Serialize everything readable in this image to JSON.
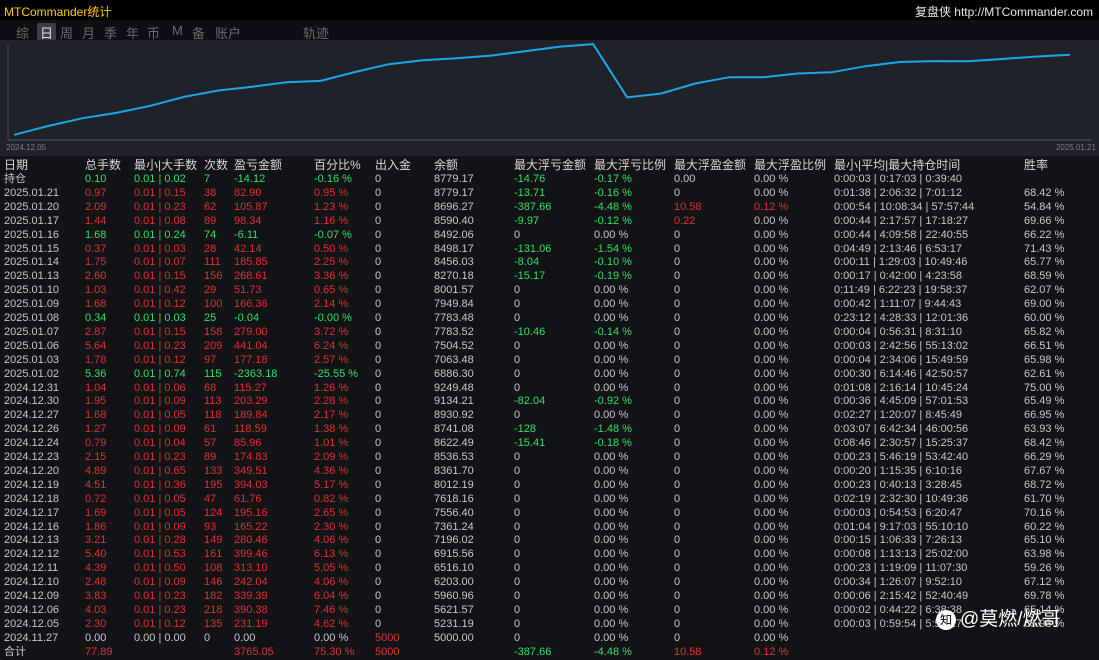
{
  "titlebar": {
    "app_title": "MTCommander统计",
    "brand": "复盘侠 http://MTCommander.com"
  },
  "tabs": [
    {
      "label": "综",
      "active": false
    },
    {
      "label": "日",
      "active": true
    },
    {
      "label": "周",
      "active": false
    },
    {
      "label": "月",
      "active": false
    },
    {
      "label": "季",
      "active": false
    },
    {
      "label": "年",
      "active": false
    },
    {
      "label": "币",
      "active": false
    },
    {
      "label": "M",
      "active": false
    },
    {
      "label": "备",
      "active": false
    },
    {
      "label": "账户",
      "active": false
    },
    {
      "label": "轨迹",
      "active": false
    }
  ],
  "colors": {
    "line": "#1ea7e8",
    "chart_bg": "#1f2329",
    "loss": "#e03030",
    "profit": "#30e060"
  },
  "chart_data": {
    "type": "line",
    "x_start_label": "2024.12.05",
    "x_end_label": "2025.01.21",
    "x": [
      "2024.12.05",
      "2024.12.06",
      "2024.12.09",
      "2024.12.10",
      "2024.12.11",
      "2024.12.12",
      "2024.12.13",
      "2024.12.16",
      "2024.12.17",
      "2024.12.18",
      "2024.12.19",
      "2024.12.20",
      "2024.12.23",
      "2024.12.24",
      "2024.12.26",
      "2024.12.27",
      "2024.12.30",
      "2024.12.31",
      "2025.01.02",
      "2025.01.03",
      "2025.01.06",
      "2025.01.07",
      "2025.01.08",
      "2025.01.09",
      "2025.01.10",
      "2025.01.13",
      "2025.01.14",
      "2025.01.15",
      "2025.01.16",
      "2025.01.17",
      "2025.01.20",
      "2025.01.21"
    ],
    "values": [
      5231.19,
      5621.57,
      5960.96,
      6203.0,
      6516.1,
      6915.56,
      7196.02,
      7361.24,
      7556.4,
      7618.16,
      8012.19,
      8361.7,
      8536.53,
      8622.49,
      8741.08,
      8930.92,
      9134.21,
      9249.48,
      6886.3,
      7063.48,
      7504.52,
      7783.52,
      7783.48,
      7949.84,
      8001.57,
      8270.18,
      8456.03,
      8498.17,
      8492.06,
      8590.4,
      8696.27,
      8779.17
    ],
    "ylim": [
      5000,
      9300
    ]
  },
  "table": {
    "headers": [
      "日期",
      "总手数",
      "最小|大手数",
      "次数",
      "盈亏金额",
      "百分比%",
      "出入金",
      "余额",
      "最大浮亏金额",
      "最大浮亏比例",
      "最大浮盈金额",
      "最大浮盈比例",
      "最小|平均|最大持仓时间",
      "胜率"
    ],
    "rows": [
      [
        "持仓",
        "0.10",
        "0.01 | 0.02",
        "7",
        "-14.12",
        "-0.16 %",
        "0",
        "8779.17",
        "-14.76",
        "-0.17 %",
        "0.00",
        "0.00 %",
        "0:00:03 | 0:17:03 | 0:39:40",
        ""
      ],
      [
        "2025.01.21",
        "0.97",
        "0.01 | 0.15",
        "38",
        "82.90",
        "0.95 %",
        "0",
        "8779.17",
        "-13.71",
        "-0.16 %",
        "0",
        "0.00 %",
        "0:01:38 | 2:06:32 | 7:01:12",
        "68.42 %"
      ],
      [
        "2025.01.20",
        "2.09",
        "0.01 | 0.23",
        "62",
        "105.87",
        "1.23 %",
        "0",
        "8696.27",
        "-387.66",
        "-4.48 %",
        "10.58",
        "0.12 %",
        "0:00:54 | 10:08:34 | 57:57:44",
        "54.84 %"
      ],
      [
        "2025.01.17",
        "1.44",
        "0.01 | 0.08",
        "89",
        "98.34",
        "1.16 %",
        "0",
        "8590.40",
        "-9.97",
        "-0.12 %",
        "0.22",
        "0.00 %",
        "0:00:44 | 2:17:57 | 17:18:27",
        "69.66 %"
      ],
      [
        "2025.01.16",
        "1.68",
        "0.01 | 0.24",
        "74",
        "-6.11",
        "-0.07 %",
        "0",
        "8492.06",
        "0",
        "0.00 %",
        "0",
        "0.00 %",
        "0:00:44 | 4:09:58 | 22:40:55",
        "66.22 %"
      ],
      [
        "2025.01.15",
        "0.37",
        "0.01 | 0.03",
        "28",
        "42.14",
        "0.50 %",
        "0",
        "8498.17",
        "-131.06",
        "-1.54 %",
        "0",
        "0.00 %",
        "0:04:49 | 2:13:46 | 6:53:17",
        "71.43 %"
      ],
      [
        "2025.01.14",
        "1.75",
        "0.01 | 0.07",
        "111",
        "185.85",
        "2.25 %",
        "0",
        "8456.03",
        "-8.04",
        "-0.10 %",
        "0",
        "0.00 %",
        "0:00:11 | 1:29:03 | 10:49:46",
        "65.77 %"
      ],
      [
        "2025.01.13",
        "2.60",
        "0.01 | 0.15",
        "156",
        "268.61",
        "3.36 %",
        "0",
        "8270.18",
        "-15.17",
        "-0.19 %",
        "0",
        "0.00 %",
        "0:00:17 | 0:42:00 | 4:23:58",
        "68.59 %"
      ],
      [
        "2025.01.10",
        "1.03",
        "0.01 | 0.42",
        "29",
        "51.73",
        "0.65 %",
        "0",
        "8001.57",
        "0",
        "0.00 %",
        "0",
        "0.00 %",
        "0:11:49 | 6:22:23 | 19:58:37",
        "62.07 %"
      ],
      [
        "2025.01.09",
        "1.68",
        "0.01 | 0.12",
        "100",
        "166.36",
        "2.14 %",
        "0",
        "7949.84",
        "0",
        "0.00 %",
        "0",
        "0.00 %",
        "0:00:42 | 1:11:07 | 9:44:43",
        "69.00 %"
      ],
      [
        "2025.01.08",
        "0.34",
        "0.01 | 0.03",
        "25",
        "-0.04",
        "-0.00 %",
        "0",
        "7783.48",
        "0",
        "0.00 %",
        "0",
        "0.00 %",
        "0:23:12 | 4:28:33 | 12:01:36",
        "60.00 %"
      ],
      [
        "2025.01.07",
        "2.87",
        "0.01 | 0.15",
        "158",
        "279.00",
        "3.72 %",
        "0",
        "7783.52",
        "-10.46",
        "-0.14 %",
        "0",
        "0.00 %",
        "0:00:04 | 0:56:31 | 8:31:10",
        "65.82 %"
      ],
      [
        "2025.01.06",
        "5.64",
        "0.01 | 0.23",
        "209",
        "441.04",
        "6.24 %",
        "0",
        "7504.52",
        "0",
        "0.00 %",
        "0",
        "0.00 %",
        "0:00:03 | 2:42:56 | 55:13:02",
        "66.51 %"
      ],
      [
        "2025.01.03",
        "1.78",
        "0.01 | 0.12",
        "97",
        "177.18",
        "2.57 %",
        "0",
        "7063.48",
        "0",
        "0.00 %",
        "0",
        "0.00 %",
        "0:00:04 | 2:34:06 | 15:49:59",
        "65.98 %"
      ],
      [
        "2025.01.02",
        "5.36",
        "0.01 | 0.74",
        "115",
        "-2363.18",
        "-25.55 %",
        "0",
        "6886.30",
        "0",
        "0.00 %",
        "0",
        "0.00 %",
        "0:00:30 | 6:14:46 | 42:50:57",
        "62.61 %"
      ],
      [
        "2024.12.31",
        "1.04",
        "0.01 | 0.06",
        "68",
        "115.27",
        "1.26 %",
        "0",
        "9249.48",
        "0",
        "0.00 %",
        "0",
        "0.00 %",
        "0:01:08 | 2:16:14 | 10:45:24",
        "75.00 %"
      ],
      [
        "2024.12.30",
        "1.95",
        "0.01 | 0.09",
        "113",
        "203.29",
        "2.28 %",
        "0",
        "9134.21",
        "-82.04",
        "-0.92 %",
        "0",
        "0.00 %",
        "0:00:36 | 4:45:09 | 57:01:53",
        "65.49 %"
      ],
      [
        "2024.12.27",
        "1.68",
        "0.01 | 0.05",
        "118",
        "189.84",
        "2.17 %",
        "0",
        "8930.92",
        "0",
        "0.00 %",
        "0",
        "0.00 %",
        "0:02:27 | 1:20:07 | 8:45:49",
        "66.95 %"
      ],
      [
        "2024.12.26",
        "1.27",
        "0.01 | 0.09",
        "61",
        "118.59",
        "1.38 %",
        "0",
        "8741.08",
        "-128",
        "-1.48 %",
        "0",
        "0.00 %",
        "0:03:07 | 6:42:34 | 46:00:56",
        "63.93 %"
      ],
      [
        "2024.12.24",
        "0.79",
        "0.01 | 0.04",
        "57",
        "85.96",
        "1.01 %",
        "0",
        "8622.49",
        "-15.41",
        "-0.18 %",
        "0",
        "0.00 %",
        "0:08:46 | 2:30:57 | 15:25:37",
        "68.42 %"
      ],
      [
        "2024.12.23",
        "2.15",
        "0.01 | 0.23",
        "89",
        "174.83",
        "2.09 %",
        "0",
        "8536.53",
        "0",
        "0.00 %",
        "0",
        "0.00 %",
        "0:00:23 | 5:46:19 | 53:42:40",
        "66.29 %"
      ],
      [
        "2024.12.20",
        "4.89",
        "0.01 | 0.65",
        "133",
        "349.51",
        "4.36 %",
        "0",
        "8361.70",
        "0",
        "0.00 %",
        "0",
        "0.00 %",
        "0:00:20 | 1:15:35 | 6:10:16",
        "67.67 %"
      ],
      [
        "2024.12.19",
        "4.51",
        "0.01 | 0.36",
        "195",
        "394.03",
        "5.17 %",
        "0",
        "8012.19",
        "0",
        "0.00 %",
        "0",
        "0.00 %",
        "0:00:23 | 0:40:13 | 3:28:45",
        "68.72 %"
      ],
      [
        "2024.12.18",
        "0.72",
        "0.01 | 0.05",
        "47",
        "61.76",
        "0.82 %",
        "0",
        "7618.16",
        "0",
        "0.00 %",
        "0",
        "0.00 %",
        "0:02:19 | 2:32:30 | 10:49:36",
        "61.70 %"
      ],
      [
        "2024.12.17",
        "1.69",
        "0.01 | 0.05",
        "124",
        "195.16",
        "2.65 %",
        "0",
        "7556.40",
        "0",
        "0.00 %",
        "0",
        "0.00 %",
        "0:00:03 | 0:54:53 | 6:20:47",
        "70.16 %"
      ],
      [
        "2024.12.16",
        "1.86",
        "0.01 | 0.09",
        "93",
        "165.22",
        "2.30 %",
        "0",
        "7361.24",
        "0",
        "0.00 %",
        "0",
        "0.00 %",
        "0:01:04 | 9:17:03 | 55:10:10",
        "60.22 %"
      ],
      [
        "2024.12.13",
        "3.21",
        "0.01 | 0.28",
        "149",
        "280.46",
        "4.06 %",
        "0",
        "7196.02",
        "0",
        "0.00 %",
        "0",
        "0.00 %",
        "0:00:15 | 1:06:33 | 7:26:13",
        "65.10 %"
      ],
      [
        "2024.12.12",
        "5.40",
        "0.01 | 0.53",
        "161",
        "399.46",
        "6.13 %",
        "0",
        "6915.56",
        "0",
        "0.00 %",
        "0",
        "0.00 %",
        "0:00:08 | 1:13:13 | 25:02:00",
        "63.98 %"
      ],
      [
        "2024.12.11",
        "4.39",
        "0.01 | 0.50",
        "108",
        "313.10",
        "5.05 %",
        "0",
        "6516.10",
        "0",
        "0.00 %",
        "0",
        "0.00 %",
        "0:00:23 | 1:19:09 | 11:07:30",
        "59.26 %"
      ],
      [
        "2024.12.10",
        "2.48",
        "0.01 | 0.09",
        "146",
        "242.04",
        "4.06 %",
        "0",
        "6203.00",
        "0",
        "0.00 %",
        "0",
        "0.00 %",
        "0:00:34 | 1:26:07 | 9:52:10",
        "67.12 %"
      ],
      [
        "2024.12.09",
        "3.83",
        "0.01 | 0.23",
        "182",
        "339.39",
        "6.04 %",
        "0",
        "5960.96",
        "0",
        "0.00 %",
        "0",
        "0.00 %",
        "0:00:06 | 2:15:42 | 52:40:49",
        "69.78 %"
      ],
      [
        "2024.12.06",
        "4.03",
        "0.01 | 0.23",
        "218",
        "390.38",
        "7.46 %",
        "0",
        "5621.57",
        "0",
        "0.00 %",
        "0",
        "0.00 %",
        "0:00:02 | 0:44:22 | 6:38:38",
        "65.14 %"
      ],
      [
        "2024.12.05",
        "2.30",
        "0.01 | 0.12",
        "135",
        "231.19",
        "4.62 %",
        "0",
        "5231.19",
        "0",
        "0.00 %",
        "0",
        "0.00 %",
        "0:00:03 | 0:59:54 | 5:54:27",
        "65.93 %"
      ],
      [
        "2024.11.27",
        "0.00",
        "0.00 | 0.00",
        "0",
        "0.00",
        "0.00 %",
        "5000",
        "5000.00",
        "0",
        "0.00 %",
        "0",
        "0.00 %",
        "",
        ""
      ],
      [
        "合计",
        "77.89",
        "",
        "",
        "3765.05",
        "75.30 %",
        "5000",
        "",
        "-387.66",
        "-4.48 %",
        "10.58",
        "0.12 %",
        "",
        ""
      ]
    ]
  },
  "watermark": {
    "text": "@莫燃/燃哥",
    "logo": "知"
  }
}
